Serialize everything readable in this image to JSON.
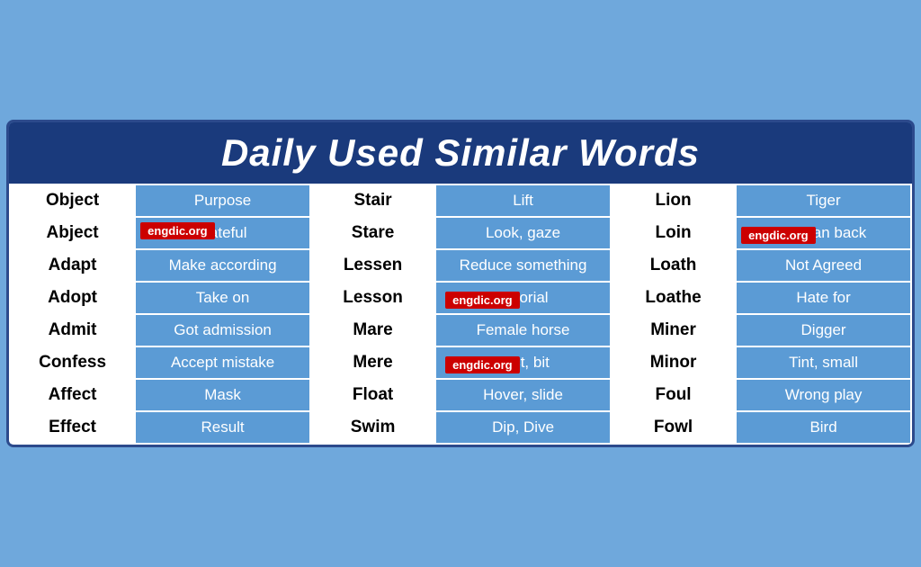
{
  "header": {
    "title": "Daily Used Similar Words"
  },
  "badges": [
    {
      "id": "badge1",
      "text": "engdic.org"
    },
    {
      "id": "badge2",
      "text": "engdic.org"
    },
    {
      "id": "badge3",
      "text": "engdic.org"
    },
    {
      "id": "badge4",
      "text": "engdic.org"
    }
  ],
  "rows": [
    [
      "Object",
      "Purpose",
      "Stair",
      "Lift",
      "Lion",
      "Tiger"
    ],
    [
      "Abject",
      "Hateful",
      "Stare",
      "Look, gaze",
      "Loin",
      "Human back"
    ],
    [
      "Adapt",
      "Make according",
      "Lessen",
      "Reduce something",
      "Loath",
      "Not Agreed"
    ],
    [
      "Adopt",
      "Take on",
      "Lesson",
      "Tutorial",
      "Loathe",
      "Hate for"
    ],
    [
      "Admit",
      "Got admission",
      "Mare",
      "Female horse",
      "Miner",
      "Digger"
    ],
    [
      "Confess",
      "Accept mistake",
      "Mere",
      "Just, bit",
      "Minor",
      "Tint, small"
    ],
    [
      "Affect",
      "Mask",
      "Float",
      "Hover, slide",
      "Foul",
      "Wrong play"
    ],
    [
      "Effect",
      "Result",
      "Swim",
      "Dip, Dive",
      "Fowl",
      "Bird"
    ]
  ]
}
